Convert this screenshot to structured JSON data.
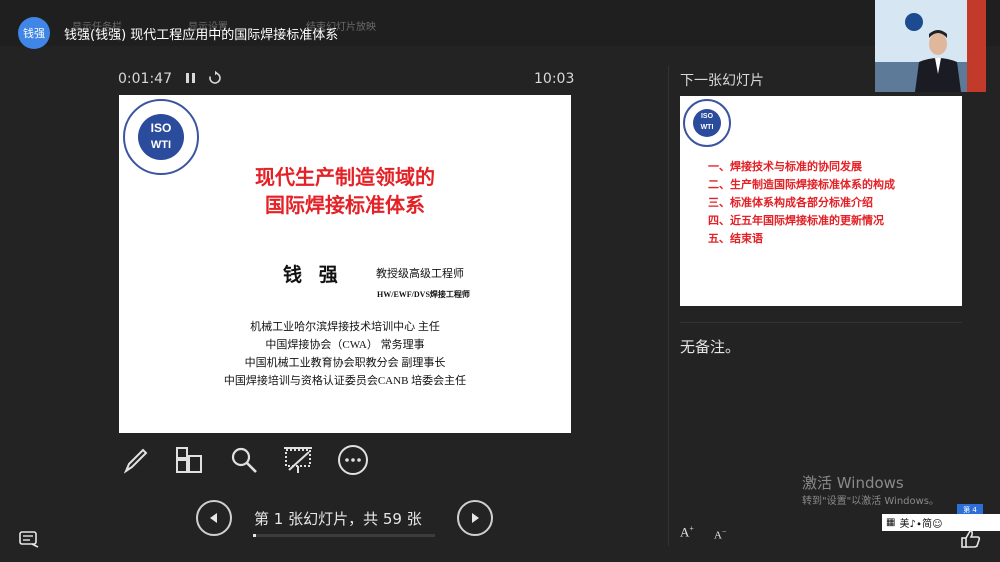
{
  "header": {
    "avatar_text": "钱强",
    "meeting_title": "钱强(钱强) 现代工程应用中的国际焊接标准体系",
    "ghost_items": [
      "显示任务栏",
      "显示设置",
      "结束幻灯片放映"
    ]
  },
  "timer": {
    "elapsed": "0:01:47",
    "clock": "10:03"
  },
  "current_slide": {
    "logo_top": "ISO",
    "logo_bottom": "WTI",
    "title_line1": "现代生产制造领域的",
    "title_line2": "国际焊接标准体系",
    "presenter": "钱 强",
    "rank": "教授级高级工程师",
    "cert": "HW/EWF/DVS焊接工程师",
    "affiliations": [
      "机械工业哈尔滨焊接技术培训中心  主任",
      "中国焊接协会（CWA） 常务理事",
      "中国机械工业教育协会职教分会  副理事长",
      "中国焊接培训与资格认证委员会CANB  培委会主任"
    ]
  },
  "tools": [
    "pen-icon",
    "see-all-slides-icon",
    "zoom-icon",
    "black-screen-icon",
    "more-options-icon"
  ],
  "navigation": {
    "counter": "第 1 张幻灯片，共 59 张",
    "current": 1,
    "total": 59,
    "progress_fraction": 0.017
  },
  "next_panel": {
    "label": "下一张幻灯片",
    "logo_top": "ISO",
    "logo_bottom": "WTI",
    "agenda": [
      "一、焊接技术与标准的协同发展",
      "二、生产制造国际焊接标准体系的构成",
      "三、标准体系构成各部分标准介绍",
      "四、近五年国际焊接标准的更新情况",
      "五、结束语"
    ]
  },
  "notes": {
    "text": "无备注。"
  },
  "font_controls": {
    "increase": "A",
    "decrease": "A"
  },
  "watermark": {
    "line1": "激活 Windows",
    "line2": "转到\"设置\"以激活 Windows。"
  },
  "ime": {
    "text": "美♪∙简☺",
    "badge": "第 4"
  },
  "colors": {
    "accent": "#3f86e6",
    "slide_title": "#e32126",
    "background": "#232323"
  }
}
